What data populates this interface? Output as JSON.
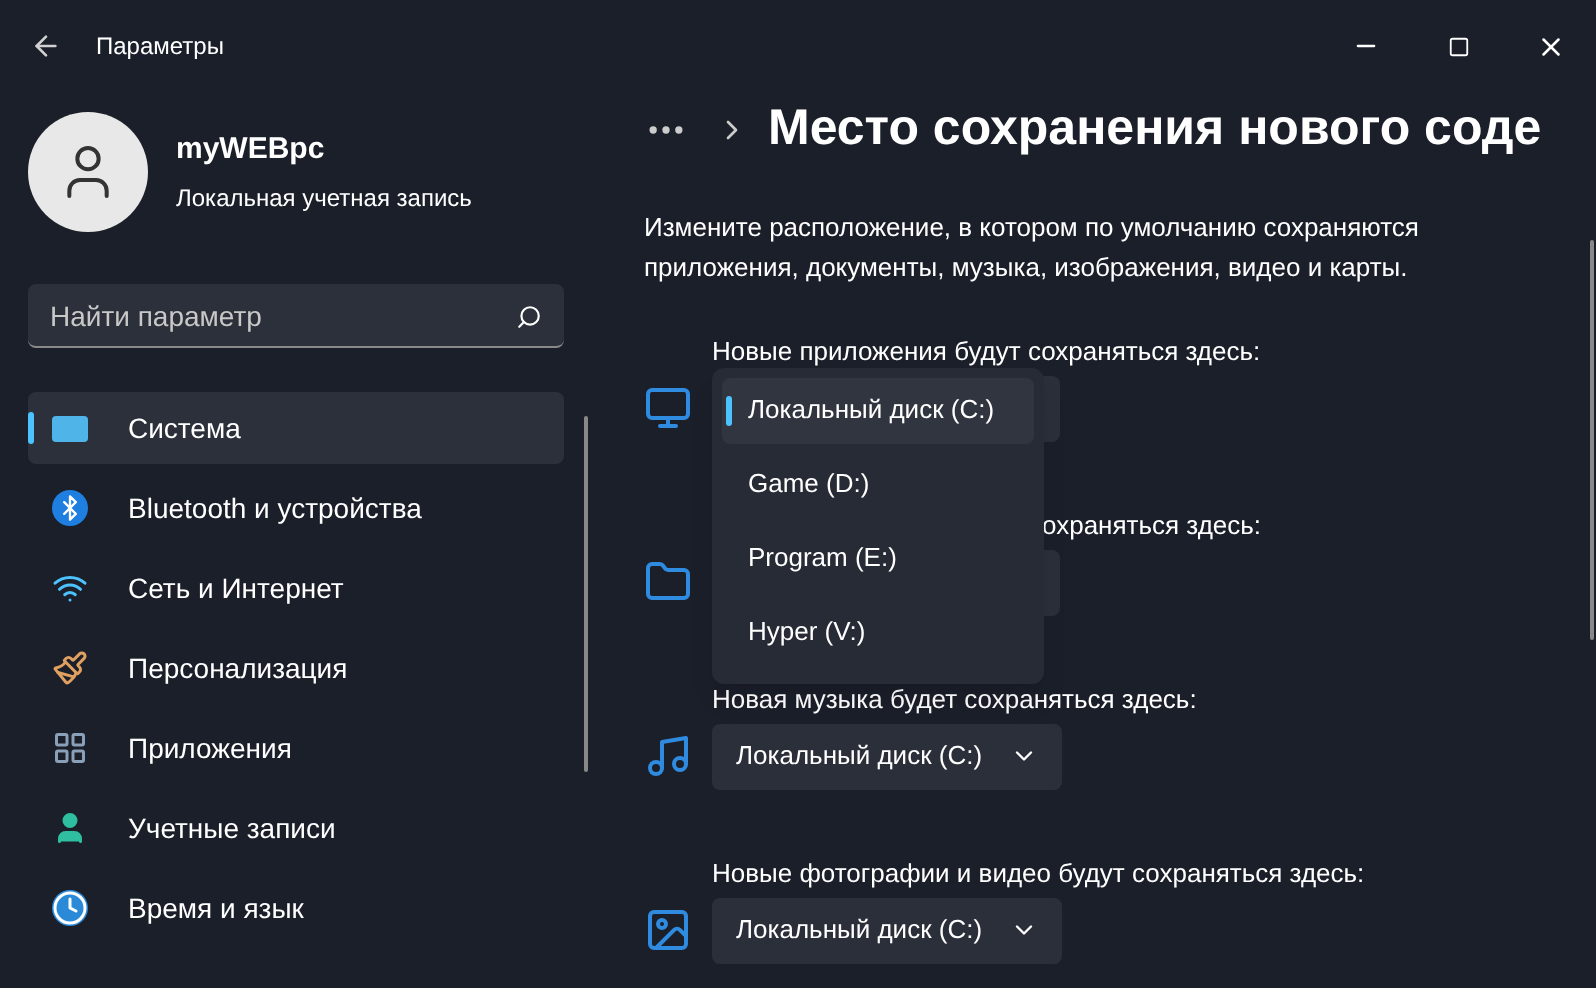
{
  "window": {
    "title": "Параметры"
  },
  "account": {
    "name": "myWEBpc",
    "type": "Локальная учетная запись"
  },
  "search": {
    "placeholder": "Найти параметр"
  },
  "sidebar": {
    "items": [
      {
        "label": "Система",
        "selected": true
      },
      {
        "label": "Bluetooth и устройства",
        "selected": false
      },
      {
        "label": "Сеть и Интернет",
        "selected": false
      },
      {
        "label": "Персонализация",
        "selected": false
      },
      {
        "label": "Приложения",
        "selected": false
      },
      {
        "label": "Учетные записи",
        "selected": false
      },
      {
        "label": "Время и язык",
        "selected": false
      }
    ]
  },
  "page": {
    "title": "Место сохранения нового соде",
    "description": "Измените расположение, в котором по умолчанию сохраняются приложения, документы, музыка, изображения, видео и карты."
  },
  "sections": [
    {
      "label": "Новые приложения будут сохраняться здесь:",
      "expanded": true,
      "covered": false,
      "options": [
        {
          "label": "Локальный диск (C:)",
          "selected": true
        },
        {
          "label": "Game (D:)",
          "selected": false
        },
        {
          "label": "Program (E:)",
          "selected": false
        },
        {
          "label": "Hyper (V:)",
          "selected": false
        }
      ]
    },
    {
      "label": "охраняться здесь:",
      "expanded": false,
      "covered": true
    },
    {
      "label": "Новая музыка будет сохраняться здесь:",
      "expanded": false,
      "covered": false,
      "value": "Локальный диск (C:)"
    },
    {
      "label": "Новые фотографии и видео будут сохраняться здесь:",
      "expanded": false,
      "covered": false,
      "value": "Локальный диск (C:)"
    }
  ]
}
